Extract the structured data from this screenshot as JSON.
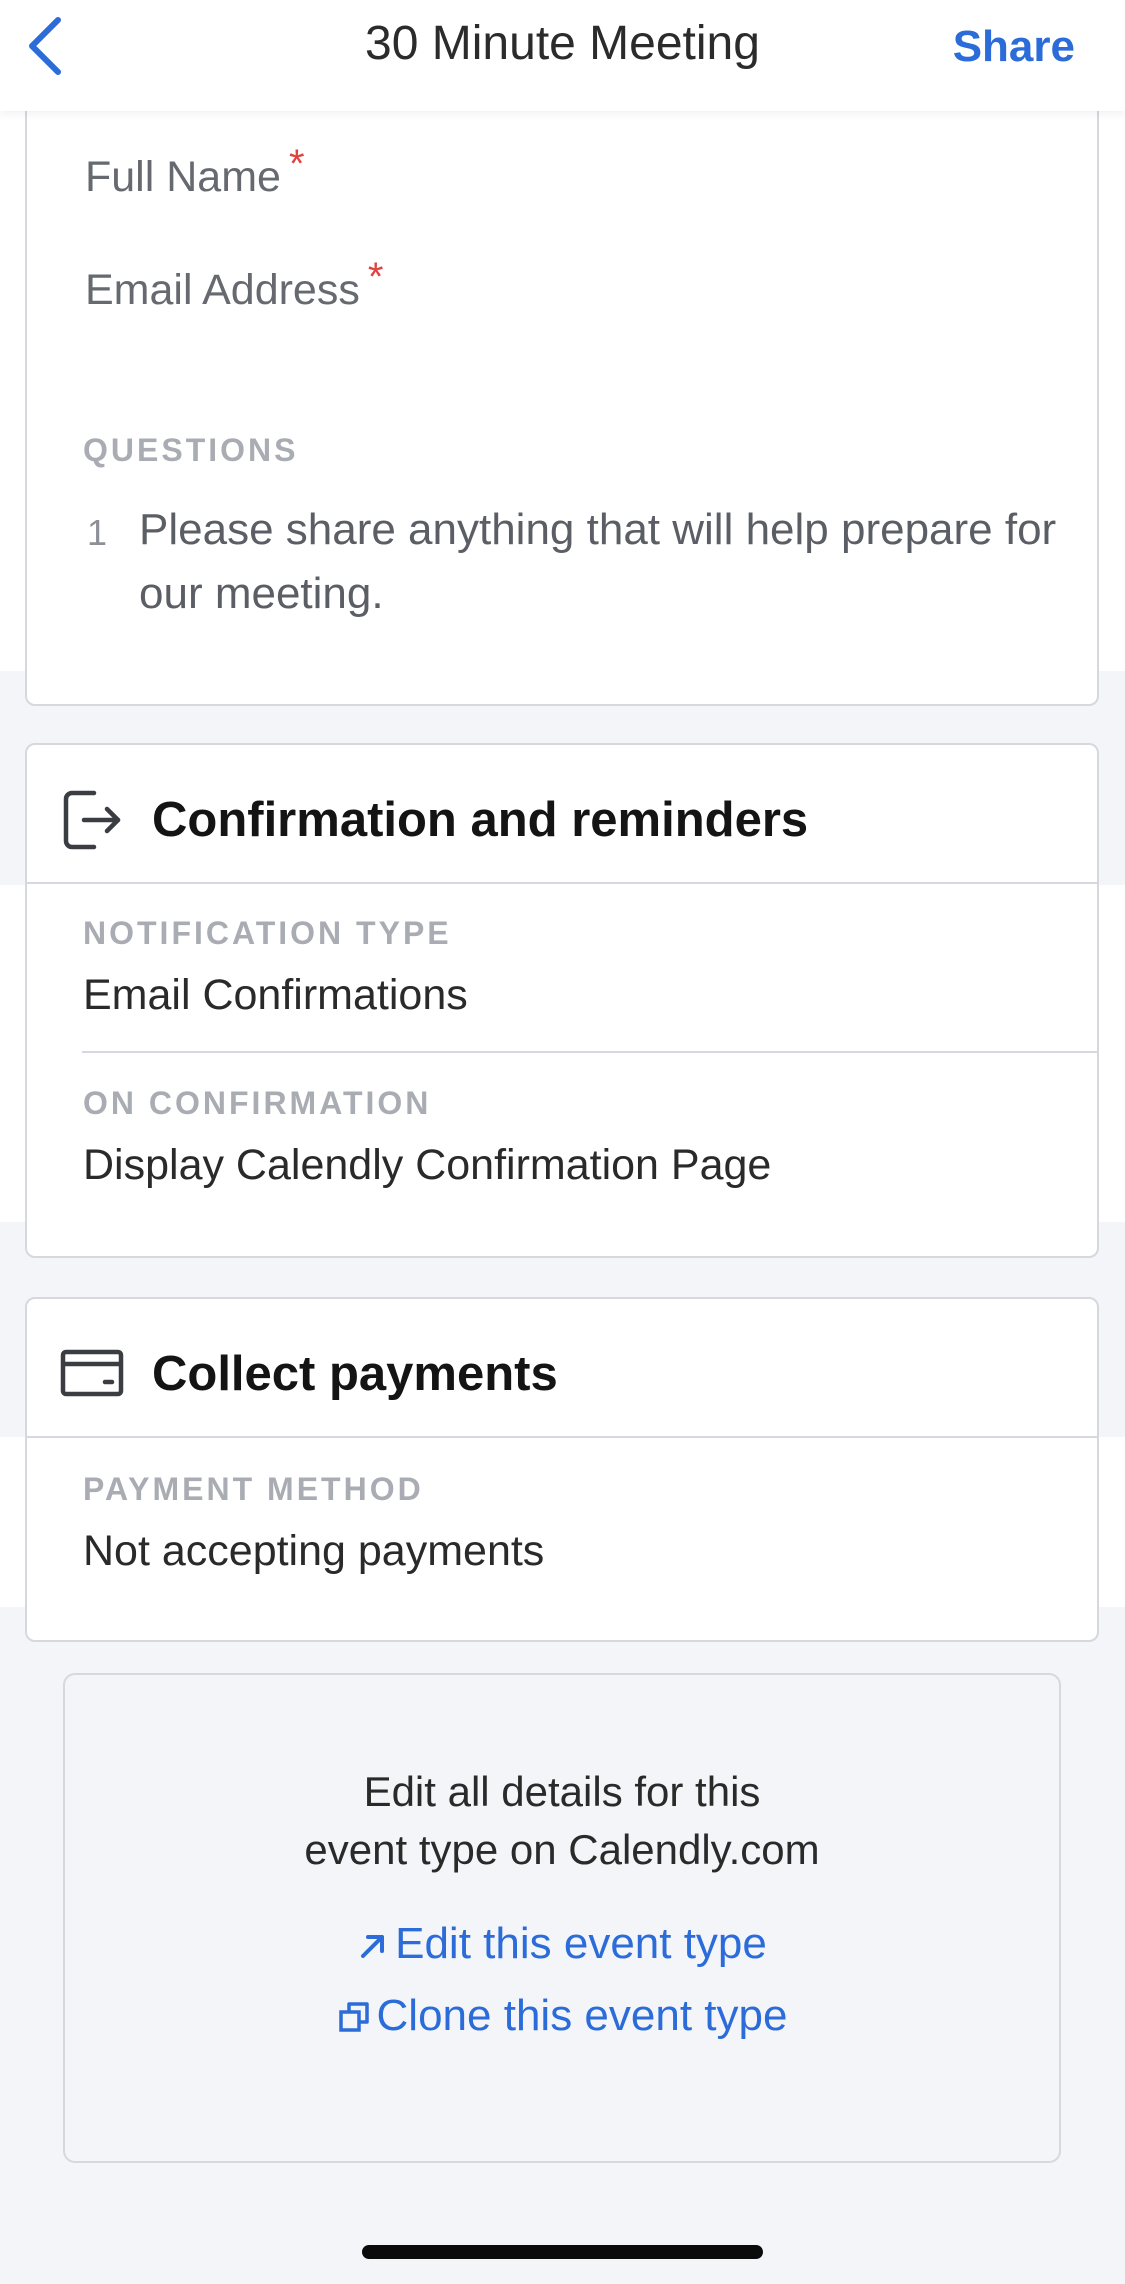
{
  "nav": {
    "title": "30 Minute Meeting",
    "share_label": "Share"
  },
  "invitee_questions": {
    "fields": [
      {
        "label": "Full Name",
        "required_mark": "*"
      },
      {
        "label": "Email Address",
        "required_mark": "*"
      }
    ],
    "questions_label": "QUESTIONS",
    "questions": [
      {
        "number": "1",
        "text": "Please share anything that will help prepare for our meeting."
      }
    ]
  },
  "confirmation": {
    "title": "Confirmation and reminders",
    "icon": "exit-arrow-icon",
    "notification_label": "NOTIFICATION TYPE",
    "notification_value": "Email Confirmations",
    "on_confirmation_label": "ON CONFIRMATION",
    "on_confirmation_value": "Display Calendly Confirmation Page"
  },
  "payments": {
    "title": "Collect payments",
    "icon": "card-icon",
    "method_label": "PAYMENT METHOD",
    "method_value": "Not accepting payments"
  },
  "footer": {
    "line1": "Edit all details for this",
    "line2": "event type on Calendly.com",
    "edit_link": "Edit this event type",
    "clone_link": "Clone this event type"
  },
  "colors": {
    "accent": "#2b6cd9",
    "required": "#e0433f",
    "background": "#f4f5f8"
  }
}
